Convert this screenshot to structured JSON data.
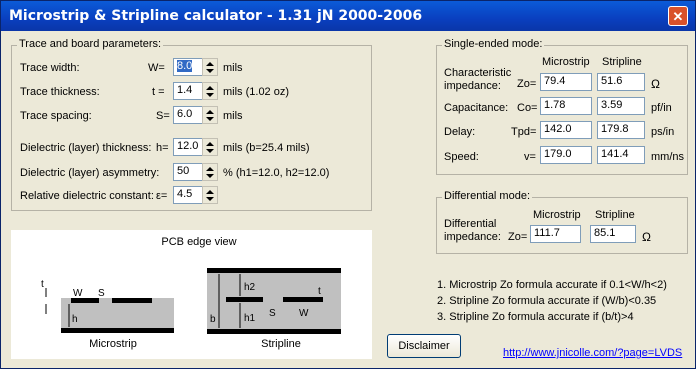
{
  "window": {
    "title": "Microstrip & Stripline calculator - 1.31 jN 2000-2006",
    "close_glyph": "✕"
  },
  "trace_group": {
    "label": "Trace and board parameters:",
    "rows": [
      {
        "label": "Trace width:",
        "sym": "W=",
        "value": "8.0",
        "unit": "mils"
      },
      {
        "label": "Trace thickness:",
        "sym": "t =",
        "value": "1.4",
        "unit": "mils (1.02 oz)"
      },
      {
        "label": "Trace spacing:",
        "sym": "S=",
        "value": "6.0",
        "unit": "mils"
      },
      {
        "label": "Dielectric (layer) thickness:",
        "sym": "h=",
        "value": "12.0",
        "unit": "mils (b=25.4 mils)"
      },
      {
        "label": "Dielectric (layer) asymmetry:",
        "sym": "",
        "value": "50",
        "unit": "% (h1=12.0, h2=12.0)"
      },
      {
        "label": "Relative dielectric constant:",
        "sym": "ε=",
        "value": "4.5",
        "unit": ""
      }
    ]
  },
  "single": {
    "label": "Single-ended mode:",
    "col_microstrip": "Microstrip",
    "col_stripline": "Stripline",
    "rows": [
      {
        "label1": "Characteristic",
        "label2": "impedance:",
        "sym": "Zo=",
        "micro": "79.4",
        "strip": "51.6",
        "unit": "Ω"
      },
      {
        "label": "Capacitance:",
        "sym": "Co=",
        "micro": "1.78",
        "strip": "3.59",
        "unit": "pf/in"
      },
      {
        "label": "Delay:",
        "sym": "Tpd=",
        "micro": "142.0",
        "strip": "179.8",
        "unit": "ps/in"
      },
      {
        "label": "Speed:",
        "sym": "v=",
        "micro": "179.0",
        "strip": "141.4",
        "unit": "mm/ns"
      }
    ]
  },
  "diff": {
    "label": "Differential mode:",
    "col_microstrip": "Microstrip",
    "col_stripline": "Stripline",
    "label1": "Differential",
    "label2": "impedance:",
    "sym": "Zo=",
    "micro": "111.7",
    "strip": "85.1",
    "unit": "Ω"
  },
  "pcb": {
    "title": "PCB edge view",
    "microstrip_caption": "Microstrip",
    "stripline_caption": "Stripline",
    "t": "t",
    "w": "W",
    "s": "S",
    "h": "h",
    "h1": "h1",
    "h2": "h2",
    "b": "b"
  },
  "notes": [
    "1. Microstrip Zo formula accurate if 0.1<W/h<2)",
    "2. Stripline Zo formula accurate if (W/b)<0.35",
    "3. Stripline Zo formula accurate if (b/t)>4"
  ],
  "disclaimer_label": "Disclaimer",
  "link_text": "http://www.jnicolle.com/?page=LVDS"
}
